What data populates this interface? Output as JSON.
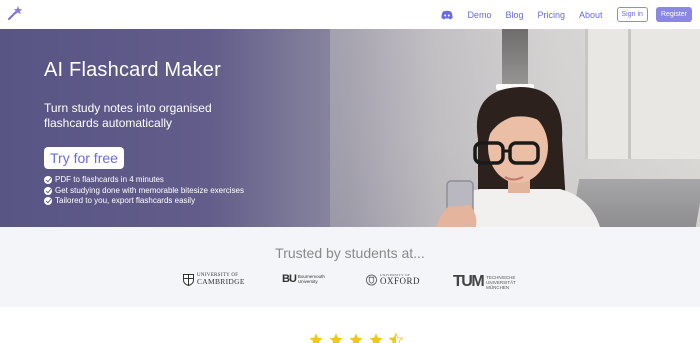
{
  "nav": {
    "links": [
      "Demo",
      "Blog",
      "Pricing",
      "About"
    ],
    "sign_in": "Sign in",
    "register": "Register"
  },
  "hero": {
    "title": "AI Flashcard Maker",
    "subtitle": "Turn study notes into organised flashcards automatically",
    "cta": "Try for free",
    "features": [
      "PDF to flashcards in 4 minutes",
      "Get studying done with memorable bitesize exercises",
      "Tailored to you, export flashcards easily"
    ]
  },
  "trusted": {
    "title": "Trusted by students at...",
    "universities": {
      "cambridge": [
        "UNIVERSITY OF",
        "CAMBRIDGE"
      ],
      "bournemouth": [
        "BU",
        "Bournemouth",
        "University"
      ],
      "oxford": [
        "UNIVERSITY OF",
        "OXFORD"
      ],
      "tum": [
        "TUM",
        "TECHNISCHE",
        "UNIVERSITÄT",
        "MÜNCHEN"
      ]
    }
  },
  "rating": {
    "stars": 4.5
  },
  "colors": {
    "accent": "#6b6bdb",
    "star": "#f5c518"
  }
}
